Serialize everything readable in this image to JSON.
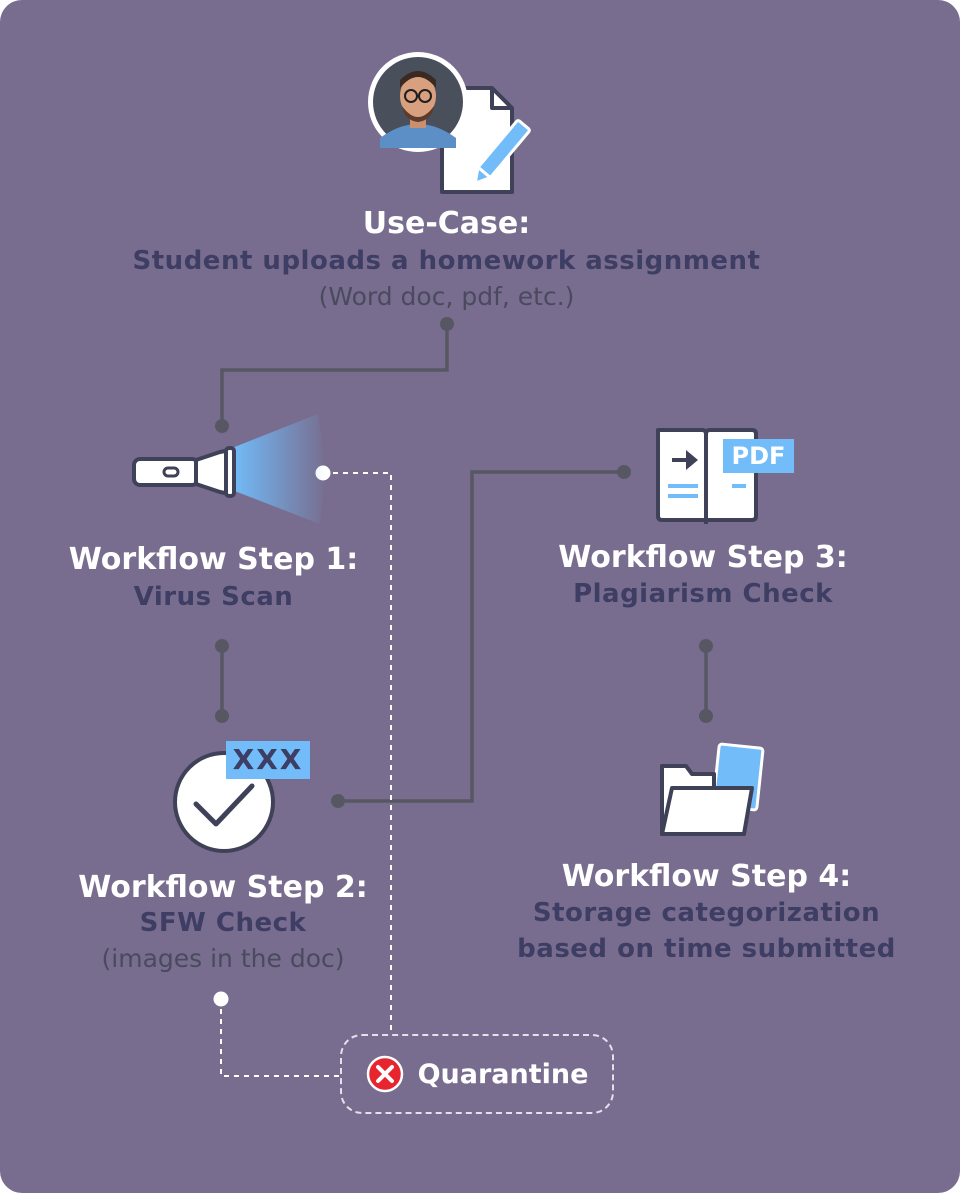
{
  "use_case": {
    "title": "Use-Case:",
    "subtitle": "Student uploads a homework assignment",
    "note": "(Word doc, pdf, etc.)"
  },
  "steps": [
    {
      "title": "Workflow Step 1:",
      "subtitle": "Virus Scan",
      "icon": "flashlight-icon"
    },
    {
      "title": "Workflow Step 2:",
      "subtitle": "SFW Check",
      "note": "(images in the doc)",
      "icon": "checkmark-circle-icon",
      "badge": "XXX"
    },
    {
      "title": "Workflow Step 3:",
      "subtitle": "Plagiarism Check",
      "icon": "open-book-pdf-icon",
      "badge": "PDF"
    },
    {
      "title": "Workflow Step 4:",
      "subtitle_line1": "Storage categorization",
      "subtitle_line2": "based on time submitted",
      "icon": "folder-icon"
    }
  ],
  "quarantine": {
    "label": "Quarantine",
    "icon": "x-circle-icon"
  },
  "colors": {
    "background": "#786d8f",
    "connector": "#575764",
    "accent_blue": "#71bcf9",
    "title_text": "#ffffff",
    "subtitle_text": "#3e3d63",
    "danger_red": "#e8242f"
  }
}
